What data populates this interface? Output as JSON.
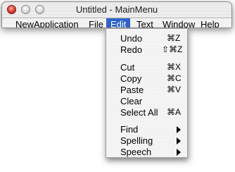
{
  "window": {
    "title": "Untitled - MainMenu"
  },
  "menubar": {
    "items": [
      "NewApplication",
      "File",
      "Edit",
      "Text",
      "Window",
      "Help"
    ],
    "active": "Edit"
  },
  "edit_menu": {
    "items": [
      {
        "label": "Undo",
        "shortcut": "⌘Z"
      },
      {
        "label": "Redo",
        "shortcut": "⇧⌘Z"
      },
      {
        "label": "Cut",
        "shortcut": "⌘X"
      },
      {
        "label": "Copy",
        "shortcut": "⌘C"
      },
      {
        "label": "Paste",
        "shortcut": "⌘V"
      },
      {
        "label": "Clear",
        "shortcut": ""
      },
      {
        "label": "Select All",
        "shortcut": "⌘A"
      },
      {
        "label": "Find",
        "submenu": true
      },
      {
        "label": "Spelling",
        "submenu": true
      },
      {
        "label": "Speech",
        "submenu": true
      }
    ]
  },
  "colors": {
    "highlight": "#2e64c9",
    "close_button": "#e5453a"
  }
}
